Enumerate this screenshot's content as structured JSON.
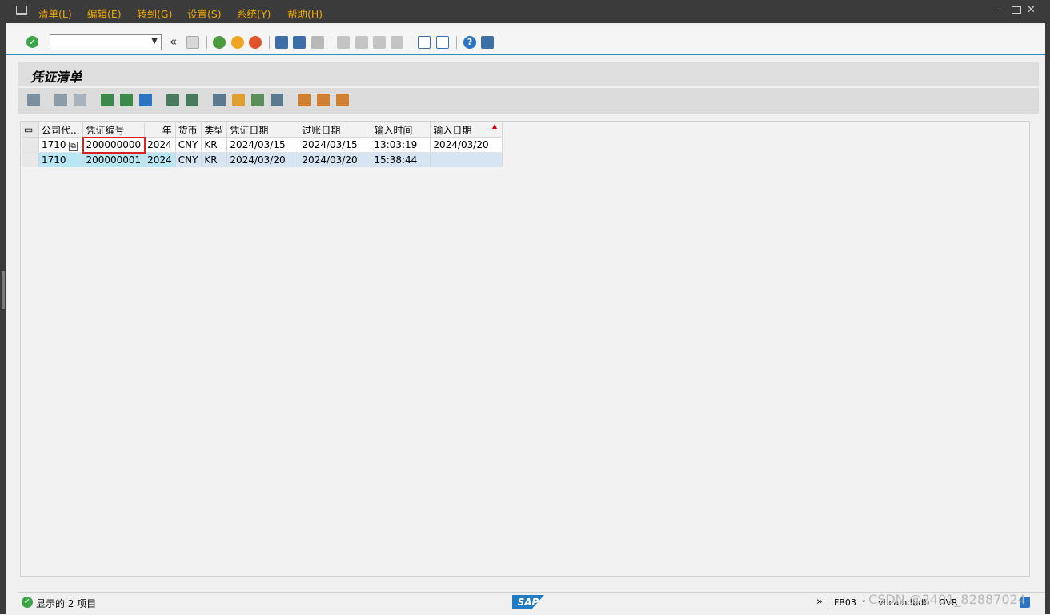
{
  "menu": {
    "items": [
      "清单(L)",
      "编辑(E)",
      "转到(G)",
      "设置(S)",
      "系统(Y)",
      "帮助(H)"
    ]
  },
  "window_icons": [
    "minimize-icon",
    "restore-icon",
    "close-icon"
  ],
  "toolbar": {
    "command_field_value": "",
    "icons": [
      "enter-icon",
      "save-icon",
      "back-icon",
      "exit-icon",
      "cancel-icon",
      "print-icon",
      "find-icon",
      "find-next-icon",
      "first-page-icon",
      "previous-page-icon",
      "next-page-icon",
      "last-page-icon",
      "create-session-icon",
      "shortcut-icon",
      "help-icon",
      "layout-icon"
    ]
  },
  "page": {
    "title": "凭证清单"
  },
  "app_toolbar": {
    "icons": [
      "details-icon",
      "select-all-icon",
      "deselect-all-icon",
      "sort-ascending-icon",
      "sort-descending-icon",
      "filter-icon",
      "total-icon",
      "subtotal-icon",
      "export-icon",
      "print-preview-icon",
      "view-icon",
      "abc-analysis-icon",
      "layout-choose-icon",
      "layout-change-icon",
      "layout-save-icon"
    ]
  },
  "grid": {
    "columns": [
      "公司代...",
      "凭证编号",
      "年",
      "货币",
      "类型",
      "凭证日期",
      "过账日期",
      "输入时间",
      "输入日期"
    ],
    "rows": [
      [
        "1710",
        "200000000",
        "2024",
        "CNY",
        "KR",
        "2024/03/15",
        "2024/03/15",
        "13:03:19",
        "2024/03/20"
      ],
      [
        "1710",
        "200000001",
        "2024",
        "CNY",
        "KR",
        "2024/03/20",
        "2024/03/20",
        "15:38:44",
        ""
      ]
    ]
  },
  "status": {
    "message": "显示的 2 项目",
    "transaction": "FB03",
    "server": "vhcalhdbdb",
    "mode": "OVR",
    "watermark": "CSDN @2401_82887024"
  },
  "colors": {
    "menubar_bg": "#3b3b3b",
    "menu_text": "#f0ab00",
    "accent_line": "#2d8ec0",
    "selected_row": "#d6e4f4",
    "highlight_box": "#e01f1f"
  }
}
